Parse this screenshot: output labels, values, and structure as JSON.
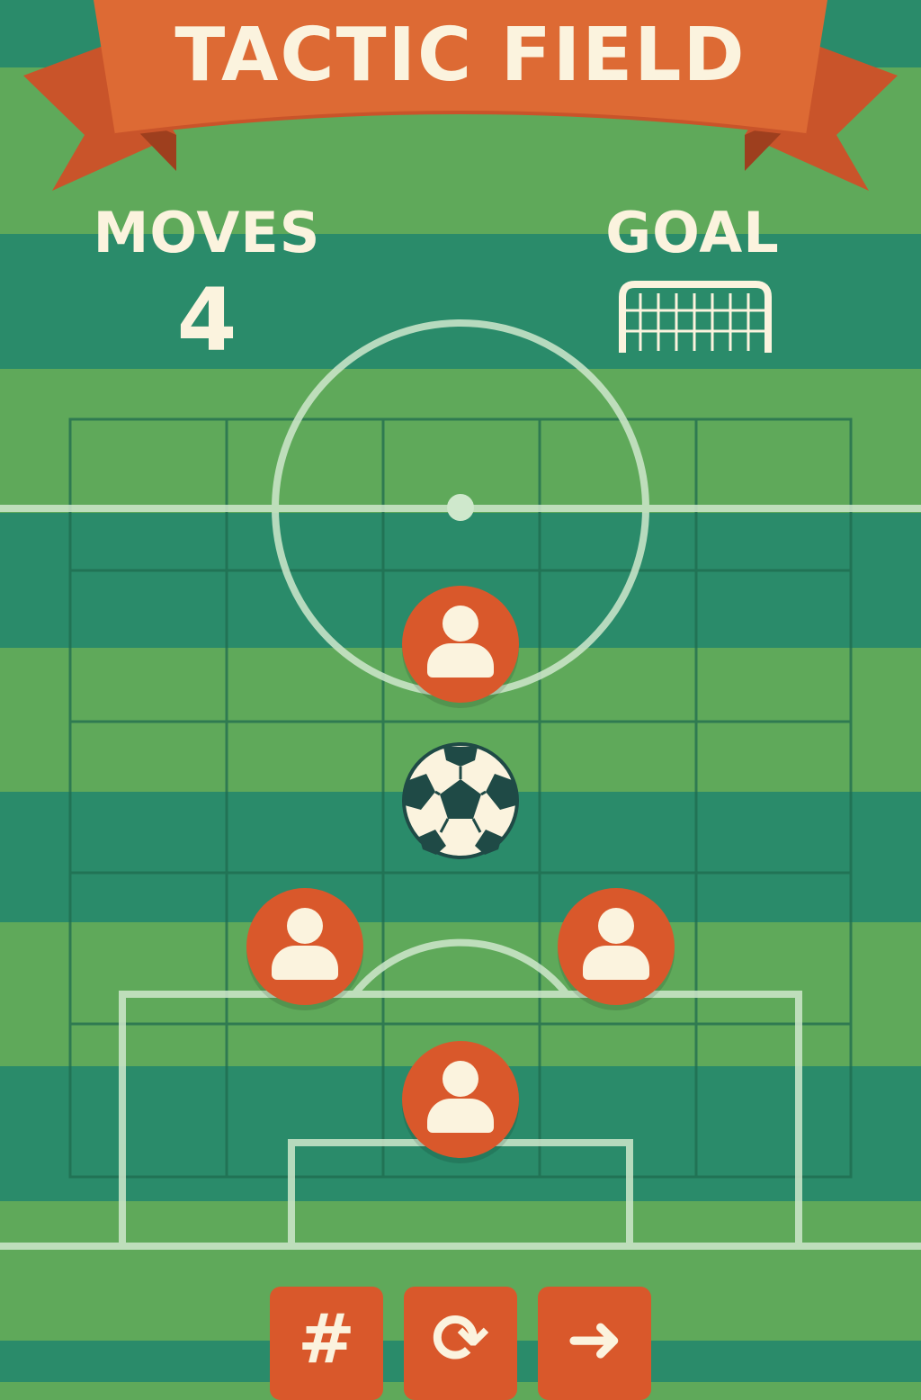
{
  "title": "TACTIC FIELD",
  "hud": {
    "moves_label": "MOVES",
    "moves_value": "4",
    "goal_label": "GOAL",
    "goal_icon": "goal-net-icon"
  },
  "board": {
    "columns": 5,
    "rows": 5,
    "players": [
      {
        "id": "player-1",
        "col": 3,
        "row": 2
      },
      {
        "id": "player-2",
        "col": 2,
        "row": 4
      },
      {
        "id": "player-3",
        "col": 4,
        "row": 4
      },
      {
        "id": "player-4",
        "col": 3,
        "row": 5
      }
    ],
    "ball": {
      "col": 3,
      "row": 3
    }
  },
  "controls": [
    {
      "id": "grid-button",
      "glyph": "#",
      "icon": "hash-icon"
    },
    {
      "id": "restart-button",
      "glyph": "⟳",
      "icon": "restart-icon"
    },
    {
      "id": "next-button",
      "glyph": "➜",
      "icon": "arrow-right-icon"
    }
  ],
  "colors": {
    "pitch_light": "#5fa95a",
    "pitch_dark": "#2a8b6a",
    "ribbon": "#dd6a34",
    "player": "#d9582b",
    "cream": "#fbf3de",
    "ball_patch": "#1f4a46"
  }
}
